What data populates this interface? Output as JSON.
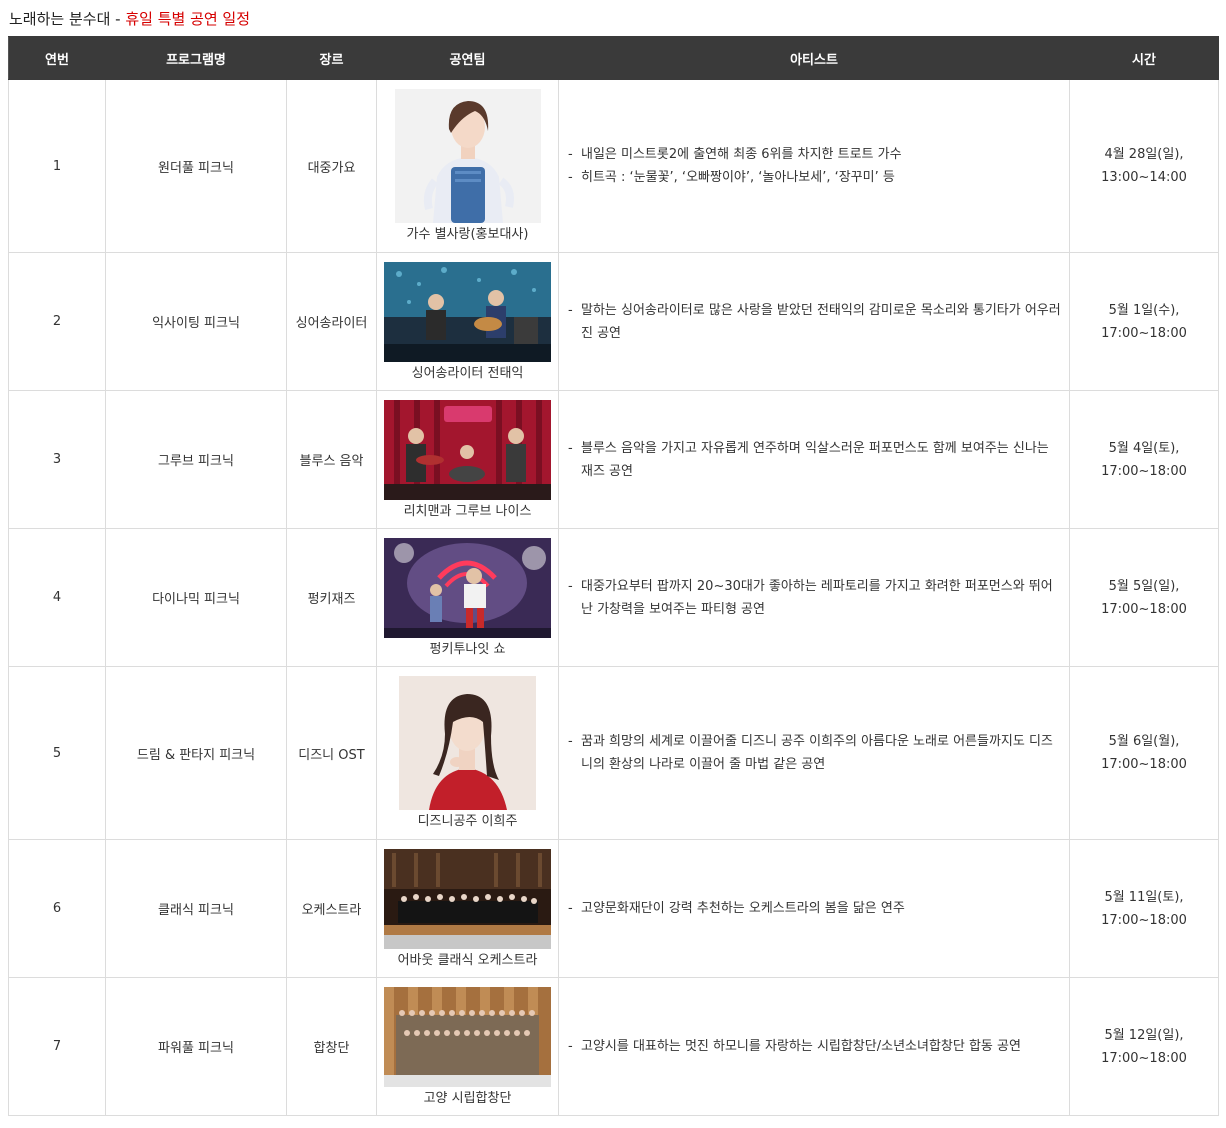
{
  "title": {
    "prefix": "노래하는 분수대 - ",
    "highlight": "휴일 특별 공연 일정",
    "highlight_color": "#d60000"
  },
  "headers": [
    "연번",
    "프로그램명",
    "장르",
    "공연팀",
    "아티스트",
    "시간"
  ],
  "rows": [
    {
      "no": "1",
      "program": "원더풀 피크닉",
      "genre": "대중가요",
      "team": "가수 별사랑(홍보대사)",
      "photo_icon": "singer-portrait-photo",
      "artist": [
        "내일은 미스트롯2에 출연해 최종 6위를 차지한 트로트 가수",
        "히트곡 : ‘눈물꽃’, ‘오빠짱이야’, ‘놀아나보세’, ‘장꾸미’ 등"
      ],
      "date": "4월 28일(일),",
      "time": "13:00~14:00"
    },
    {
      "no": "2",
      "program": "익사이팅 피크닉",
      "genre": "싱어송라이터",
      "team": "싱어송라이터 전태익",
      "photo_icon": "band-stage-photo",
      "artist": [
        "말하는 싱어송라이터로 많은 사랑을 받았던 전태익의 감미로운 목소리와 통기타가 어우러진 공연"
      ],
      "date": "5월 1일(수),",
      "time": "17:00~18:00"
    },
    {
      "no": "3",
      "program": "그루브 피크닉",
      "genre": "블루스 음악",
      "team": "리치맨과 그루브 나이스",
      "photo_icon": "blues-band-photo",
      "artist": [
        "블루스 음악을 가지고 자유롭게 연주하며 익살스러운 퍼포먼스도 함께 보여주는 신나는 재즈 공연"
      ],
      "date": "5월 4일(토),",
      "time": "17:00~18:00"
    },
    {
      "no": "4",
      "program": "다이나믹 피크닉",
      "genre": "펑키재즈",
      "team": "펑키투나잇 쇼",
      "photo_icon": "dance-show-photo",
      "artist": [
        "대중가요부터 팝까지 20~30대가 좋아하는 레파토리를 가지고 화려한 퍼포먼스와 뛰어난 가창력을 보여주는 파티형 공연"
      ],
      "date": "5월 5일(일),",
      "time": "17:00~18:00"
    },
    {
      "no": "5",
      "program": "드림 & 판타지 피크닉",
      "genre": "디즈니 OST",
      "team": "디즈니공주 이희주",
      "photo_icon": "singer-portrait-photo",
      "artist": [
        "꿈과 희망의 세계로 이끌어줄 디즈니 공주 이희주의 아름다운 노래로 어른들까지도 디즈니의 환상의 나라로 이끌어 줄 마법 같은 공연"
      ],
      "date": "5월 6일(월),",
      "time": "17:00~18:00"
    },
    {
      "no": "6",
      "program": "클래식 피크닉",
      "genre": "오케스트라",
      "team": "어바웃 클래식 오케스트라",
      "photo_icon": "orchestra-photo",
      "artist": [
        "고양문화재단이 강력 추천하는 오케스트라의 봄을 닮은 연주"
      ],
      "date": "5월 11일(토),",
      "time": "17:00~18:00"
    },
    {
      "no": "7",
      "program": "파워풀 피크닉",
      "genre": "합창단",
      "team": "고양 시립합창단",
      "photo_icon": "choir-photo",
      "artist": [
        "고양시를 대표하는 멋진 하모니를 자랑하는 시립합창단/소년소녀합창단 합동 공연"
      ],
      "date": "5월 12일(일),",
      "time": "17:00~18:00"
    }
  ],
  "colors": {
    "header_bg": "#3a3a3a",
    "border": "#dcdcdc"
  }
}
